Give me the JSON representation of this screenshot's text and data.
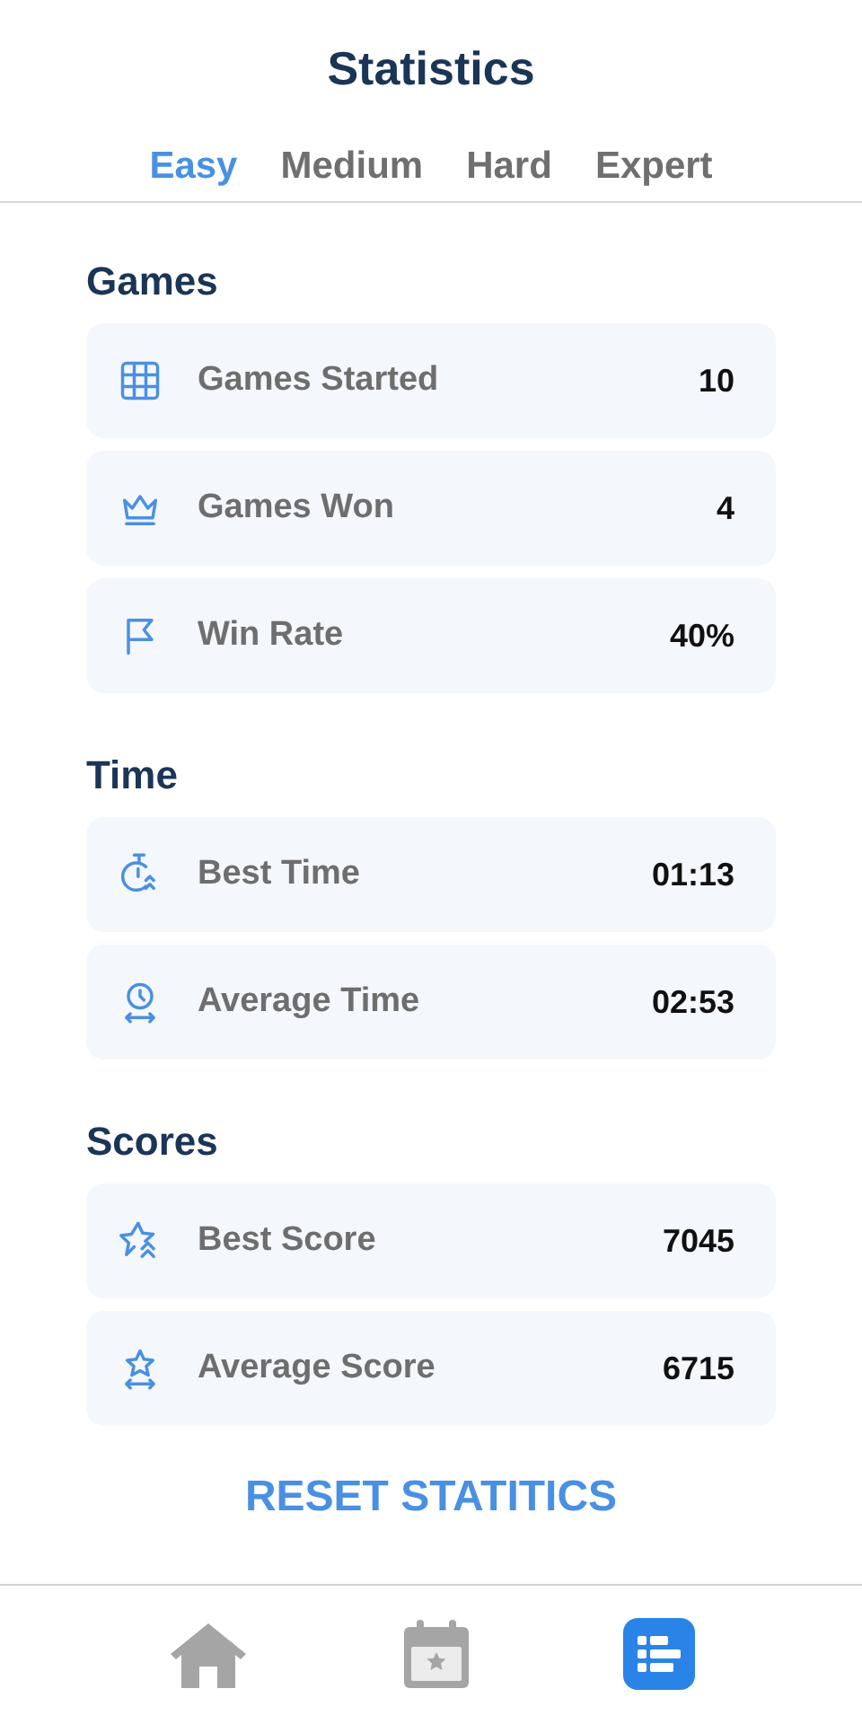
{
  "title": "Statistics",
  "tabs": [
    {
      "label": "Easy",
      "selected": true
    },
    {
      "label": "Medium",
      "selected": false
    },
    {
      "label": "Hard",
      "selected": false
    },
    {
      "label": "Expert",
      "selected": false
    }
  ],
  "sections": [
    {
      "heading": "Games",
      "rows": [
        {
          "kind": "grid",
          "label": "Games Started",
          "value": "10"
        },
        {
          "kind": "crown",
          "label": "Games Won",
          "value": "4"
        },
        {
          "kind": "flag",
          "label": "Win Rate",
          "value": "40%"
        }
      ]
    },
    {
      "heading": "Time",
      "rows": [
        {
          "kind": "stopwatch",
          "label": "Best Time",
          "value": "01:13"
        },
        {
          "kind": "clock",
          "label": "Average Time",
          "value": "02:53"
        }
      ]
    },
    {
      "heading": "Scores",
      "rows": [
        {
          "kind": "star",
          "label": "Best Score",
          "value": "7045"
        },
        {
          "kind": "staraverage",
          "label": "Average Score",
          "value": "6715"
        }
      ]
    }
  ],
  "reset_button": "RESET STATITICS",
  "nav": [
    {
      "kind": "home",
      "selected": false
    },
    {
      "kind": "calendar",
      "selected": false
    },
    {
      "kind": "stats",
      "selected": true
    }
  ]
}
